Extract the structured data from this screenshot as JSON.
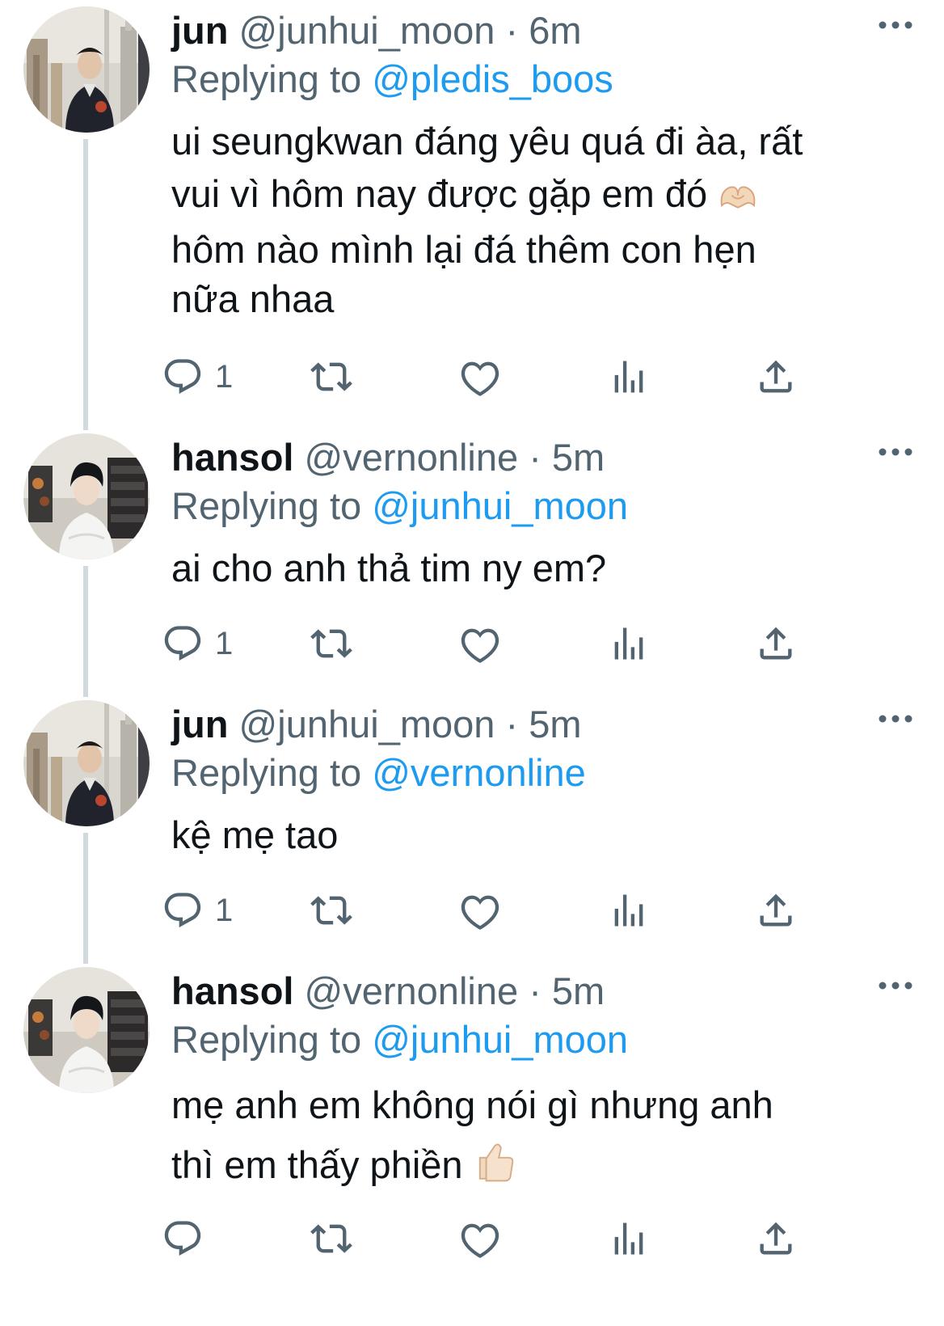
{
  "tweets": [
    {
      "name": "jun",
      "handle": "@junhui_moon",
      "separator": "·",
      "time": "6m",
      "replying_label": "Replying to",
      "reply_to": "@pledis_boos",
      "text_lines": [
        "ui seungkwan đáng yêu quá đi àa, rất",
        "vui vì hôm nay được gặp em đó",
        "hôm nào mình lại đá thêm con hẹn",
        "nữa nhaa"
      ],
      "reply_count": "1"
    },
    {
      "name": "hansol",
      "handle": "@vernonline",
      "separator": "·",
      "time": "5m",
      "replying_label": "Replying to",
      "reply_to": "@junhui_moon",
      "text_lines": [
        "ai cho anh thả tim ny em?"
      ],
      "reply_count": "1"
    },
    {
      "name": "jun",
      "handle": "@junhui_moon",
      "separator": "·",
      "time": "5m",
      "replying_label": "Replying to",
      "reply_to": "@vernonline",
      "text_lines": [
        "kệ mẹ tao"
      ],
      "reply_count": "1"
    },
    {
      "name": "hansol",
      "handle": "@vernonline",
      "separator": "·",
      "time": "5m",
      "replying_label": "Replying to",
      "reply_to": "@junhui_moon",
      "text_lines": [
        "mẹ anh em không nói gì nhưng anh",
        "thì em thấy phiền"
      ],
      "reply_count": ""
    }
  ],
  "icons": {
    "reply": "reply-icon",
    "retweet": "retweet-icon",
    "like": "heart-icon",
    "views": "views-icon",
    "share": "share-icon",
    "more": "more-icon",
    "heart_hands_emoji": "heart-hands-emoji",
    "thumbs_up_emoji": "thumbs-up-emoji"
  },
  "colors": {
    "mention": "#1d9bf0",
    "secondary": "#536471",
    "thread_line": "#cfd9de"
  }
}
